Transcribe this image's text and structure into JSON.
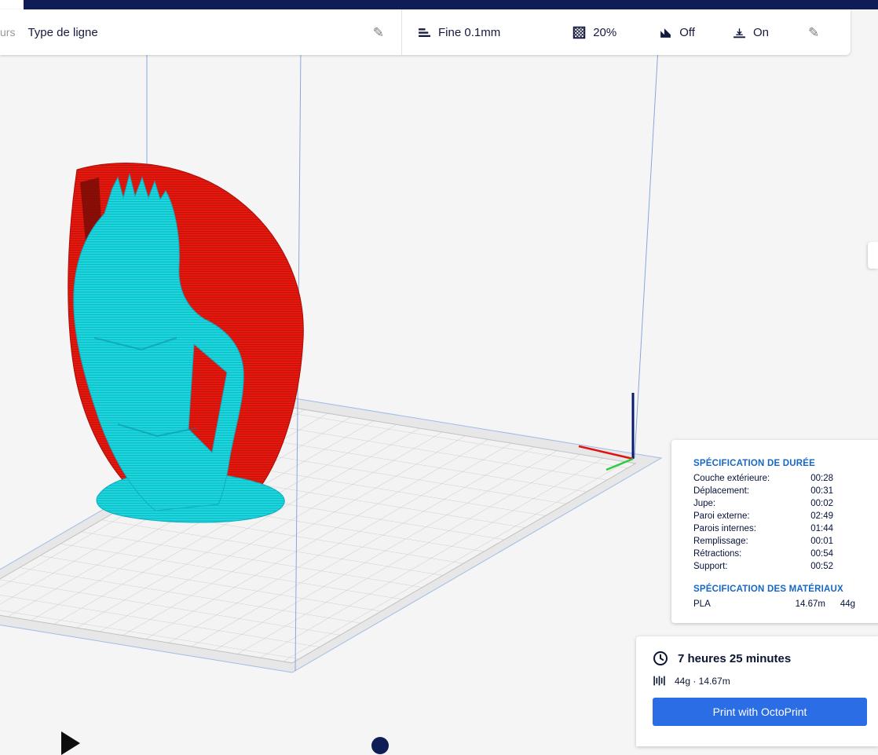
{
  "toolbar": {
    "left_partial": "urs",
    "view_mode": "Type de ligne",
    "edit_icon": "✎",
    "settings": {
      "profile": "Fine 0.1mm",
      "infill": "20%",
      "support_label": "Off",
      "adhesion_label": "On"
    }
  },
  "time_panel": {
    "duration_title": "SPÉCIFICATION DE DURÉE",
    "rows": [
      {
        "label": "Couche extérieure:",
        "value": "00:28"
      },
      {
        "label": "Déplacement:",
        "value": "00:31"
      },
      {
        "label": "Jupe:",
        "value": "00:02"
      },
      {
        "label": "Paroi externe:",
        "value": "02:49"
      },
      {
        "label": "Parois internes:",
        "value": "01:44"
      },
      {
        "label": "Remplissage:",
        "value": "00:01"
      },
      {
        "label": "Rétractions:",
        "value": "00:54"
      },
      {
        "label": "Support:",
        "value": "00:52"
      }
    ],
    "material_title": "SPÉCIFICATION DES MATÉRIAUX",
    "material": {
      "name": "PLA",
      "length": "14.67m",
      "weight": "44g"
    }
  },
  "action_panel": {
    "time_estimate": "7 heures 25 minutes",
    "material_estimate": "44g · 14.67m",
    "print_button": "Print with OctoPrint"
  },
  "colors": {
    "accent_blue": "#2a6de5",
    "header_blue": "#1767c4",
    "navy": "#0e1d55",
    "model_cyan": "#1bd9dd",
    "model_red": "#e8170e"
  }
}
